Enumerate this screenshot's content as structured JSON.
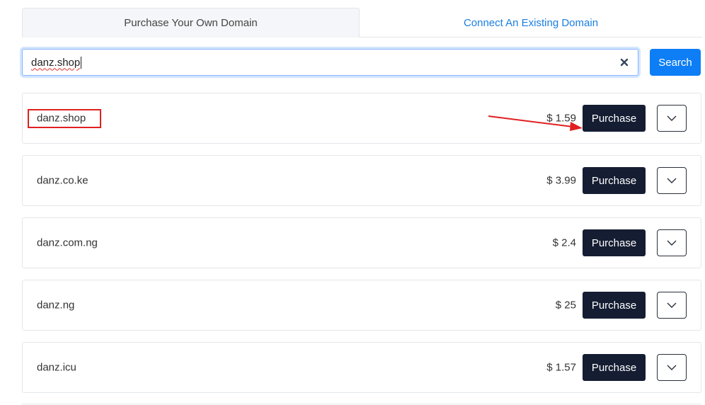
{
  "tabs": {
    "purchase": "Purchase Your Own Domain",
    "connect": "Connect An Existing Domain"
  },
  "search": {
    "value": "danz.shop",
    "button_label": "Search"
  },
  "results": [
    {
      "domain": "danz.shop",
      "price": "$ 1.59",
      "action": "Purchase"
    },
    {
      "domain": "danz.co.ke",
      "price": "$ 3.99",
      "action": "Purchase"
    },
    {
      "domain": "danz.com.ng",
      "price": "$ 2.4",
      "action": "Purchase"
    },
    {
      "domain": "danz.ng",
      "price": "$ 25",
      "action": "Purchase"
    },
    {
      "domain": "danz.icu",
      "price": "$ 1.57",
      "action": "Purchase"
    }
  ],
  "icons": {
    "clear": "close-icon",
    "expand": "chevron-down-icon"
  },
  "colors": {
    "accent": "#0d7ef5",
    "link": "#1a7fe0",
    "purchase_button": "#151d33",
    "annotation": "#e02020"
  }
}
